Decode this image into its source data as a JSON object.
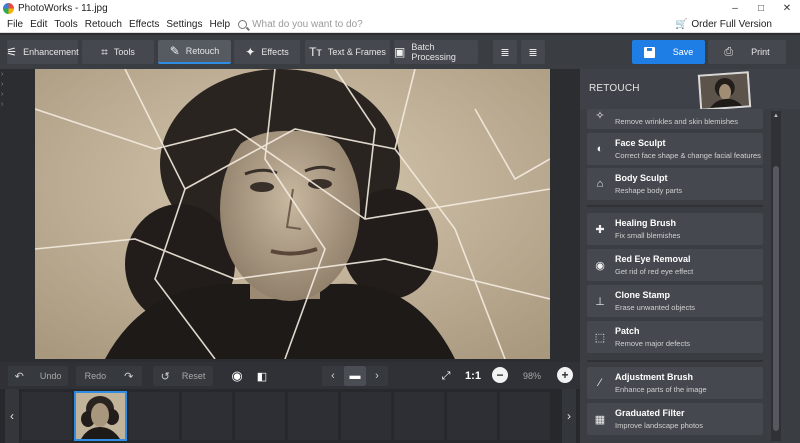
{
  "window": {
    "title": "PhotoWorks - 11.jpg",
    "controls": [
      "–",
      "□",
      "✕"
    ]
  },
  "menu": {
    "items": [
      "File",
      "Edit",
      "Tools",
      "Retouch",
      "Effects",
      "Settings",
      "Help"
    ],
    "search_placeholder": "What do you want to do?",
    "order_label": "Order Full Version"
  },
  "toolbar": {
    "tabs": [
      {
        "label": "Enhancement",
        "icon": "sliders-icon",
        "glyph": "⚟"
      },
      {
        "label": "Tools",
        "icon": "crop-icon",
        "glyph": "⌗"
      },
      {
        "label": "Retouch",
        "icon": "brush-icon",
        "glyph": "✎",
        "active": true
      },
      {
        "label": "Effects",
        "icon": "magic-wand-icon",
        "glyph": "✦"
      },
      {
        "label": "Text & Frames",
        "icon": "text-icon",
        "glyph": "Tт"
      },
      {
        "label": "Batch Processing",
        "icon": "batch-icon",
        "glyph": "▣"
      }
    ],
    "save_label": "Save",
    "print_label": "Print",
    "accent": "#1f7ee6"
  },
  "controls": {
    "undo_label": "Undo",
    "redo_label": "Redo",
    "reset_label": "Reset",
    "ratio_label": "1:1",
    "zoom": "98%"
  },
  "retouch_panel": {
    "title": "RETOUCH",
    "tools": [
      {
        "name": "",
        "desc": "Remove wrinkles and skin blemishes",
        "icon": "face-retouch-icon",
        "glyph": "✧"
      },
      {
        "name": "Face Sculpt",
        "desc": "Correct face shape & change facial features",
        "icon": "face-sculpt-icon",
        "glyph": "◐"
      },
      {
        "name": "Body Sculpt",
        "desc": "Reshape body parts",
        "icon": "body-sculpt-icon",
        "glyph": "⌂"
      },
      {
        "name": "Healing Brush",
        "desc": "Fix small blemishes",
        "icon": "healing-brush-icon",
        "glyph": "✚"
      },
      {
        "name": "Red Eye Removal",
        "desc": "Get rid of red eye effect",
        "icon": "eye-icon",
        "glyph": "◉"
      },
      {
        "name": "Clone Stamp",
        "desc": "Erase unwanted objects",
        "icon": "stamp-icon",
        "glyph": "⊥"
      },
      {
        "name": "Patch",
        "desc": "Remove major defects",
        "icon": "patch-icon",
        "glyph": "⬚"
      },
      {
        "name": "Adjustment Brush",
        "desc": "Enhance parts of the image",
        "icon": "adjustment-brush-icon",
        "glyph": "⁄"
      },
      {
        "name": "Graduated Filter",
        "desc": "Improve landscape photos",
        "icon": "graduated-filter-icon",
        "glyph": "▦"
      }
    ]
  }
}
